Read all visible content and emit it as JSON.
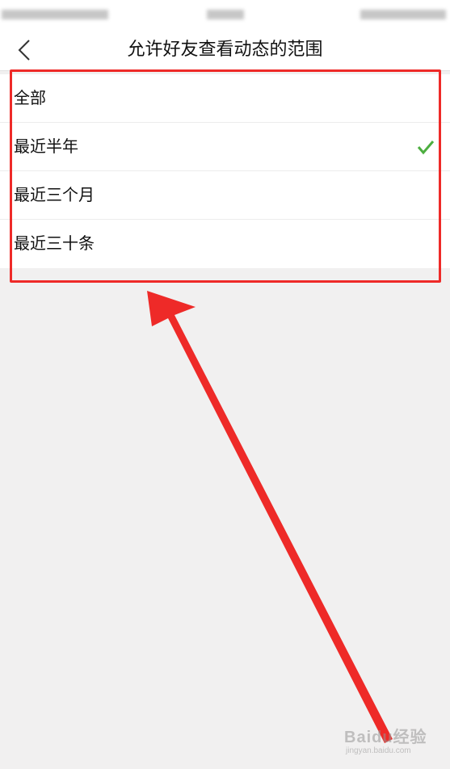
{
  "nav": {
    "title": "允许好友查看动态的范围"
  },
  "options": [
    {
      "label": "全部",
      "selected": false
    },
    {
      "label": "最近半年",
      "selected": true
    },
    {
      "label": "最近三个月",
      "selected": false
    },
    {
      "label": "最近三十条",
      "selected": false
    }
  ],
  "watermark": {
    "brand": "Baidu经验",
    "url": "jingyan.baidu.com"
  },
  "colors": {
    "accent_check": "#4cae3f",
    "annotation_red": "#ee2a28",
    "background": "#f1f0f0"
  },
  "icons": {
    "back": "chevron-left-icon",
    "selected": "checkmark-icon"
  }
}
